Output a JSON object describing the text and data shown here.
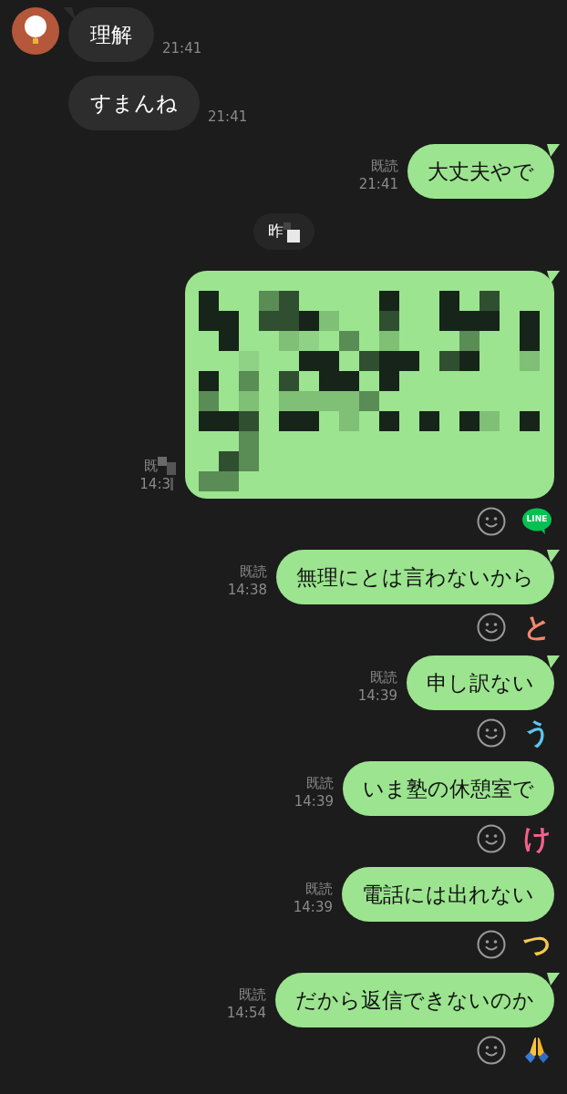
{
  "messages": [
    {
      "kind": "received",
      "avatar": true,
      "tail": true,
      "text": "理解",
      "time": "21:41"
    },
    {
      "kind": "received",
      "avatar": false,
      "tail": false,
      "text": "すまんね",
      "time": "21:41"
    },
    {
      "kind": "sent",
      "tail": true,
      "read": "既読",
      "time": "21:41",
      "text": "大丈夫やで"
    },
    {
      "kind": "date",
      "text": "昨",
      "partially_redacted": true
    },
    {
      "kind": "sent-redacted",
      "tail": true,
      "read": "既",
      "time": "14:3",
      "reaction": {
        "kind": "logo",
        "text": "LINE"
      }
    },
    {
      "kind": "sent",
      "tail": true,
      "read": "既読",
      "time": "14:38",
      "text": "無理にとは言わないから",
      "reaction": {
        "kind": "kana",
        "text": "と",
        "color": "#f28a6c"
      }
    },
    {
      "kind": "sent",
      "tail": true,
      "read": "既読",
      "time": "14:39",
      "text": "申し訳ない",
      "reaction": {
        "kind": "kana",
        "text": "う",
        "color": "#5cc6ee"
      }
    },
    {
      "kind": "sent",
      "tail": false,
      "read": "既読",
      "time": "14:39",
      "text": "いま塾の休憩室で",
      "reaction": {
        "kind": "kana",
        "text": "け",
        "color": "#f2628c"
      }
    },
    {
      "kind": "sent",
      "tail": false,
      "read": "既読",
      "time": "14:39",
      "text": "電話には出れない",
      "reaction": {
        "kind": "kana",
        "text": "つ",
        "color": "#f6c84a"
      }
    },
    {
      "kind": "sent",
      "tail": true,
      "read": "既読",
      "time": "14:54",
      "text": "だから返信できないのか",
      "reaction": {
        "kind": "emoji-pray"
      }
    }
  ]
}
